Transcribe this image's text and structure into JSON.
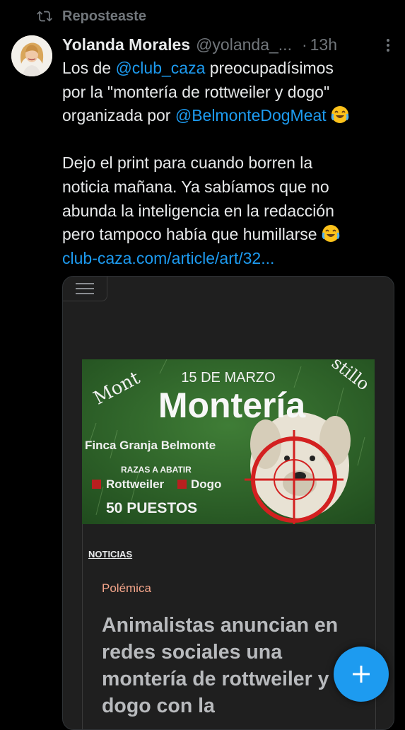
{
  "repost": {
    "label": "Reposteaste"
  },
  "post": {
    "author_name": "Yolanda Morales",
    "author_handle": "@yolanda_...",
    "separator": "·",
    "time": "13h",
    "text": {
      "l1_a": "Los de ",
      "l1_mention": "@club_caza",
      "l1_b": " preocupadísimos",
      "l2": "por la \"montería de rottweiler y dogo\"",
      "l3_a": "organizada por ",
      "l3_mention": "@BelmonteDogMeat",
      "l4": "Dejo el print para cuando borren la",
      "l5": "noticia mañana. Ya sabíamos que no",
      "l6": "abunda la inteligencia en la redacción",
      "l7": "pero tampoco había que humillarse",
      "link": "club-caza.com/article/art/32..."
    },
    "emoji": "laughing-with-tears"
  },
  "poster": {
    "arc_left": "Mont",
    "arc_right": "stillo",
    "date": "15 DE MARZO",
    "title": "Montería",
    "location": "Finca Granja Belmonte",
    "breeds_heading": "RAZAS A ABATIR",
    "breed_1": "Rottweiler",
    "breed_2": "Dogo",
    "spots": "50 PUESTOS",
    "background_color": "#2f6b2c"
  },
  "article": {
    "category": "NOTICIAS",
    "tag": "Polémica",
    "title_l1": "Animalistas anuncian en",
    "title_l2": "redes sociales una",
    "title_l3": "montería de rottweiler y",
    "title_l4": "dogo con la"
  },
  "colors": {
    "accent": "#1d9bf0",
    "muted": "#71767b",
    "text": "#e7e9ea",
    "tag": "#f4a58a"
  },
  "fab": {
    "icon": "plus-icon"
  }
}
